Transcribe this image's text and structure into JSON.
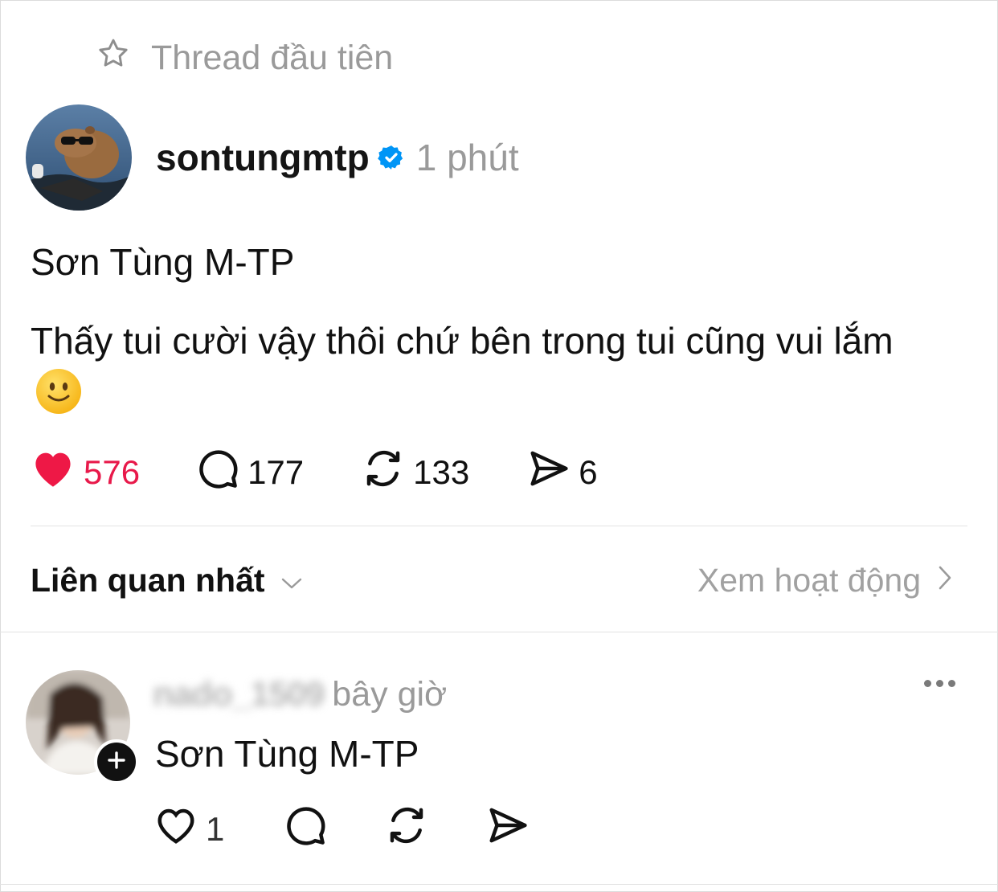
{
  "header": {
    "label": "Thread đầu tiên",
    "icon": "star-outline-icon"
  },
  "post": {
    "username": "sontungmtp",
    "verified": true,
    "time": "1 phút",
    "author_line": "Sơn Tùng M-TP",
    "text": "Thấy tui cười vậy thôi chứ bên trong tui cũng vui lắm",
    "emoji": "slightly-smiling-face-icon",
    "stats": {
      "likes": "576",
      "comments": "177",
      "reposts": "133",
      "shares": "6"
    },
    "liked": true
  },
  "sort": {
    "label": "Liên quan nhất",
    "view_activity": "Xem hoạt động"
  },
  "reply": {
    "username": "nado_1509",
    "time": "bây giờ",
    "text": "Sơn Tùng M-TP",
    "stats": {
      "likes": "1"
    }
  },
  "colors": {
    "like_red": "#e8194a",
    "verified_blue": "#0095f6",
    "muted_gray": "#9a9a9a"
  }
}
